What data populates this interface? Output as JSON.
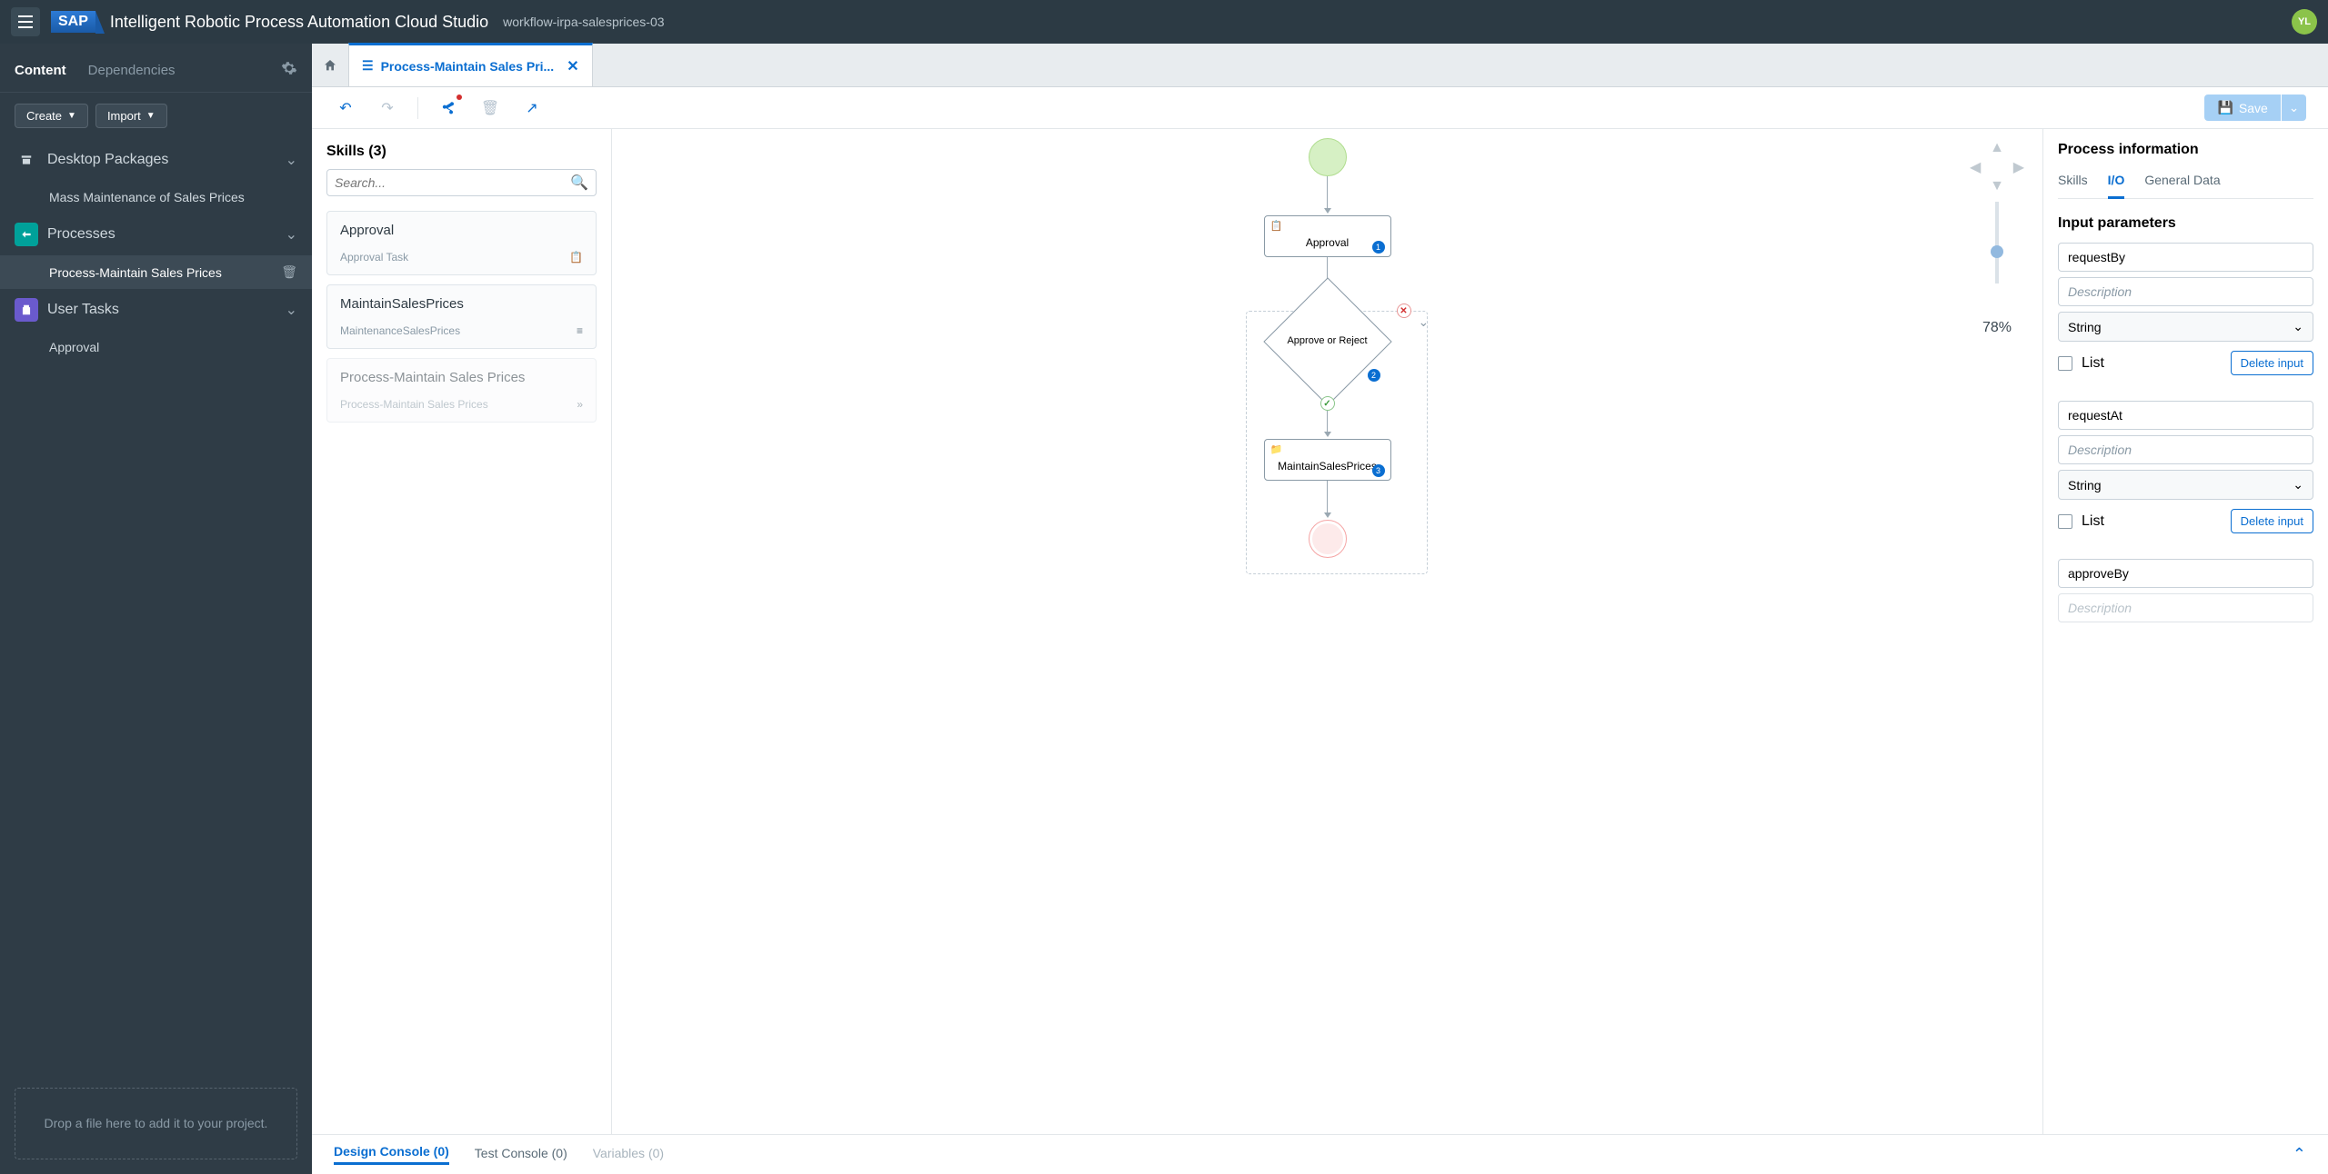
{
  "header": {
    "app_title": "Intelligent Robotic Process Automation Cloud Studio",
    "project_name": "workflow-irpa-salesprices-03",
    "avatar_initials": "YL"
  },
  "sidebar": {
    "tabs": {
      "content": "Content",
      "dependencies": "Dependencies"
    },
    "actions": {
      "create": "Create",
      "import": "Import"
    },
    "groups": {
      "desktop_packages": "Desktop Packages",
      "processes": "Processes",
      "user_tasks": "User Tasks"
    },
    "items": {
      "mass_maintenance": "Mass Maintenance of Sales Prices",
      "process_maintain": "Process-Maintain Sales Prices",
      "approval": "Approval"
    },
    "drop_zone": "Drop a file here to add it to your project."
  },
  "tabs": {
    "process_tab": "Process-Maintain Sales Pri..."
  },
  "toolbar": {
    "save_label": "Save"
  },
  "skills": {
    "title": "Skills (3)",
    "search_placeholder": "Search...",
    "cards": [
      {
        "title": "Approval",
        "sub": "Approval Task"
      },
      {
        "title": "MaintainSalesPrices",
        "sub": "MaintenanceSalesPrices"
      },
      {
        "title": "Process-Maintain Sales Prices",
        "sub": "Process-Maintain Sales Prices"
      }
    ]
  },
  "flow": {
    "approval": "Approval",
    "decision": "Approve or Reject",
    "maintain": "MaintainSalesPrices",
    "badges": {
      "b1": "1",
      "b2": "2",
      "b3": "3"
    }
  },
  "zoom": {
    "label": "78%"
  },
  "right_panel": {
    "title": "Process information",
    "tabs": {
      "skills": "Skills",
      "io": "I/O",
      "general": "General Data"
    },
    "section": "Input parameters",
    "desc_placeholder": "Description",
    "list_label": "List",
    "delete_label": "Delete input",
    "type_string": "String",
    "params": {
      "p1": "requestBy",
      "p2": "requestAt",
      "p3": "approveBy"
    }
  },
  "bottom": {
    "design": "Design Console (0)",
    "test": "Test Console (0)",
    "variables": "Variables (0)"
  }
}
